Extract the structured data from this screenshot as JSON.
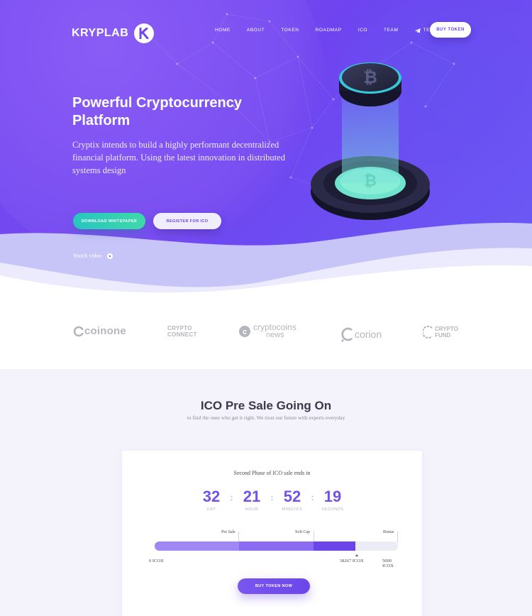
{
  "brand": {
    "name": "KRYPLAB",
    "badge_letter": "K"
  },
  "nav": {
    "items": [
      "HOME",
      "ABOUT",
      "TOKEN",
      "ROADMAP",
      "ICO",
      "TEAM"
    ],
    "telegram": "TELEGRAM",
    "buy_token": "BUY TOKEN"
  },
  "hero": {
    "title": "Powerful Cryptocurrency Platform",
    "subtitle": "Cryptix intends to build a highly performant decentralized financial platform. Using the latest innovation in distributed systems design",
    "download_button": "DOWNLOAD WHITEPAPER",
    "register_button": "REGISTER FOR ICO",
    "watch_video": "Watch video"
  },
  "partners": {
    "coinone": "coinone",
    "crypto_connect_line1": "CRYPTO",
    "crypto_connect_line2": "CONNECT",
    "cryptocoins_line1": "cryptocoins",
    "cryptocoins_line2": "news",
    "corion": "corion",
    "crypto_fund_line1": "CRYPTO",
    "crypto_fund_line2": "FUND"
  },
  "ico": {
    "title": "ICO Pre Sale Going On",
    "subtitle": "to find the ones who get it right. We trust our future with experts everyday",
    "card_title": "Second Phase of ICO sale ends in",
    "countdown": {
      "days": "32",
      "days_label": "DAY",
      "hours": "21",
      "hours_label": "HOUR",
      "minutes": "52",
      "minutes_label": "MINUTES",
      "seconds": "19",
      "seconds_label": "SECONDS"
    },
    "progress": {
      "pre_sale": "Pre Sale",
      "soft_cap": "Soft Cap",
      "bonus": "Bonus",
      "min_label": "0 ICOX",
      "current_label": "38267 ICOX",
      "max_label": "5000 ICOX"
    },
    "buy_button": "BUY TOKEN NOW"
  },
  "colors": {
    "accent": "#6c45ea",
    "teal": "#27c6c0",
    "hero_bg": "#7048f0"
  }
}
